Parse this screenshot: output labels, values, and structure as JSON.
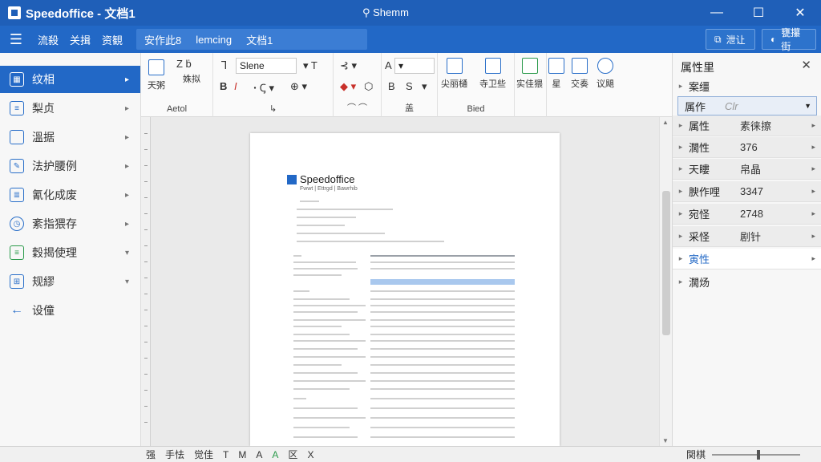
{
  "window": {
    "title": "Speedoffice - 文档1",
    "search": "Shemm",
    "controls": {
      "minimize": "—",
      "maximize": "☐",
      "close": "✕"
    }
  },
  "menubar": {
    "menus": [
      "流殺",
      "关揖",
      "资観"
    ],
    "doc_tabs": [
      "安作此8",
      "lemcing",
      "文档1"
    ],
    "right_buttons": [
      "泄让",
      "甕攥街"
    ]
  },
  "sidebar": {
    "items": [
      {
        "label": "纹相",
        "icon": "grid-icon",
        "active": true
      },
      {
        "label": "梨贞",
        "icon": "list-icon",
        "active": false
      },
      {
        "label": "溫据",
        "icon": "document-icon",
        "active": false
      },
      {
        "label": "法护腰例",
        "icon": "edit-doc-icon",
        "active": false
      },
      {
        "label": "氰化成废",
        "icon": "form-icon",
        "active": false
      },
      {
        "label": "紊指猥存",
        "icon": "clock-icon",
        "active": false
      },
      {
        "label": "穀揭使理",
        "icon": "sheet-icon",
        "active": false
      },
      {
        "label": "规繆",
        "icon": "table-icon",
        "active": false
      },
      {
        "label": "设僮",
        "icon": "back-arrow-icon",
        "active": false
      }
    ]
  },
  "ribbon": {
    "groups": [
      {
        "label": "Aetol",
        "buttons": [
          "天粥",
          "姝拟"
        ]
      },
      {
        "label": "↳",
        "font_name": "Slene",
        "bold": "B",
        "italic": "I"
      },
      {
        "label": "盖",
        "style": "A"
      },
      {
        "label": "Bied",
        "buttons": [
          "尖丽樋",
          "寺卫些"
        ]
      },
      {
        "label": "",
        "buttons": [
          "实佳猥"
        ]
      },
      {
        "label": "",
        "buttons": [
          "星",
          "交奏",
          "议飓"
        ]
      }
    ]
  },
  "document": {
    "brand": "Speedoffice",
    "subtitle": "Fwwt  |  Ettrgd  |  Bawrhib"
  },
  "rpanel": {
    "title": "属性里",
    "rows": [
      {
        "k": "案缰",
        "v": ""
      },
      {
        "k": "属性",
        "v": "素徕擦"
      },
      {
        "k": "濶性",
        "v": "376"
      },
      {
        "k": "天瞜",
        "v": "帛晶"
      },
      {
        "k": "腴作哩",
        "v": "3347"
      },
      {
        "k": "宛怪",
        "v": "2748"
      },
      {
        "k": "采怪",
        "v": "剧针"
      },
      {
        "k": "寅性",
        "v": ""
      },
      {
        "k": "濶炀",
        "v": ""
      }
    ],
    "selected": {
      "k": "属作",
      "v": "Clr"
    }
  },
  "statusbar": {
    "items": [
      "强",
      "手怯",
      "觉佳",
      "T",
      "M",
      "A",
      "A",
      "区",
      "X"
    ],
    "zoom_label": "関棋"
  }
}
